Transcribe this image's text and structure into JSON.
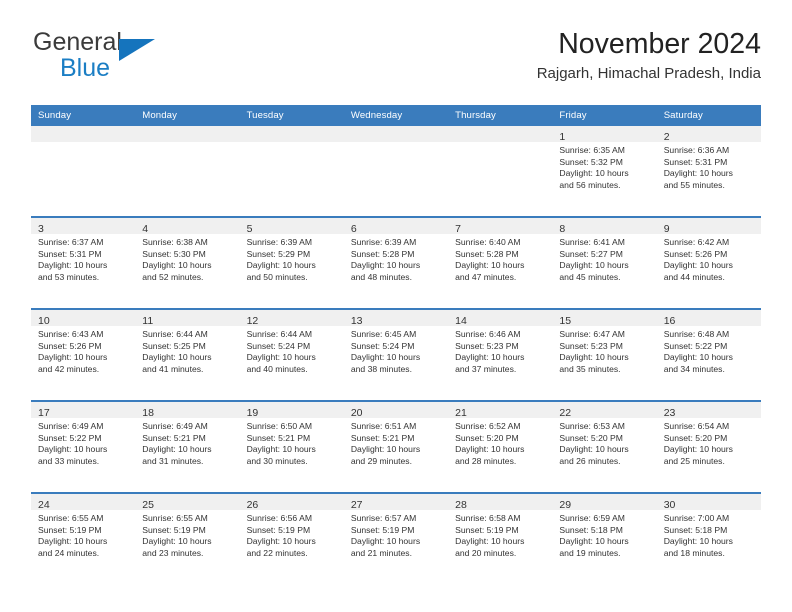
{
  "brand": {
    "name_top": "General",
    "name_bottom": "Blue",
    "color_dark": "#3b3b3b",
    "color_blue": "#1b7ec4",
    "triangle_color": "#1574bd"
  },
  "header": {
    "title": "November 2024",
    "subtitle": "Rajgarh, Himachal Pradesh, India"
  },
  "theme": {
    "header_blue": "#3a7cbd",
    "row_divider": "#3a7cbd",
    "daynum_band": "#f0f0f0",
    "text": "#333333"
  },
  "weekday_headers": [
    "Sunday",
    "Monday",
    "Tuesday",
    "Wednesday",
    "Thursday",
    "Friday",
    "Saturday"
  ],
  "weeks": [
    [
      {
        "day": "",
        "sunrise": "",
        "sunset": "",
        "daylight_1": "",
        "daylight_2": ""
      },
      {
        "day": "",
        "sunrise": "",
        "sunset": "",
        "daylight_1": "",
        "daylight_2": ""
      },
      {
        "day": "",
        "sunrise": "",
        "sunset": "",
        "daylight_1": "",
        "daylight_2": ""
      },
      {
        "day": "",
        "sunrise": "",
        "sunset": "",
        "daylight_1": "",
        "daylight_2": ""
      },
      {
        "day": "",
        "sunrise": "",
        "sunset": "",
        "daylight_1": "",
        "daylight_2": ""
      },
      {
        "day": "1",
        "sunrise": "Sunrise: 6:35 AM",
        "sunset": "Sunset: 5:32 PM",
        "daylight_1": "Daylight: 10 hours",
        "daylight_2": "and 56 minutes."
      },
      {
        "day": "2",
        "sunrise": "Sunrise: 6:36 AM",
        "sunset": "Sunset: 5:31 PM",
        "daylight_1": "Daylight: 10 hours",
        "daylight_2": "and 55 minutes."
      }
    ],
    [
      {
        "day": "3",
        "sunrise": "Sunrise: 6:37 AM",
        "sunset": "Sunset: 5:31 PM",
        "daylight_1": "Daylight: 10 hours",
        "daylight_2": "and 53 minutes."
      },
      {
        "day": "4",
        "sunrise": "Sunrise: 6:38 AM",
        "sunset": "Sunset: 5:30 PM",
        "daylight_1": "Daylight: 10 hours",
        "daylight_2": "and 52 minutes."
      },
      {
        "day": "5",
        "sunrise": "Sunrise: 6:39 AM",
        "sunset": "Sunset: 5:29 PM",
        "daylight_1": "Daylight: 10 hours",
        "daylight_2": "and 50 minutes."
      },
      {
        "day": "6",
        "sunrise": "Sunrise: 6:39 AM",
        "sunset": "Sunset: 5:28 PM",
        "daylight_1": "Daylight: 10 hours",
        "daylight_2": "and 48 minutes."
      },
      {
        "day": "7",
        "sunrise": "Sunrise: 6:40 AM",
        "sunset": "Sunset: 5:28 PM",
        "daylight_1": "Daylight: 10 hours",
        "daylight_2": "and 47 minutes."
      },
      {
        "day": "8",
        "sunrise": "Sunrise: 6:41 AM",
        "sunset": "Sunset: 5:27 PM",
        "daylight_1": "Daylight: 10 hours",
        "daylight_2": "and 45 minutes."
      },
      {
        "day": "9",
        "sunrise": "Sunrise: 6:42 AM",
        "sunset": "Sunset: 5:26 PM",
        "daylight_1": "Daylight: 10 hours",
        "daylight_2": "and 44 minutes."
      }
    ],
    [
      {
        "day": "10",
        "sunrise": "Sunrise: 6:43 AM",
        "sunset": "Sunset: 5:26 PM",
        "daylight_1": "Daylight: 10 hours",
        "daylight_2": "and 42 minutes."
      },
      {
        "day": "11",
        "sunrise": "Sunrise: 6:44 AM",
        "sunset": "Sunset: 5:25 PM",
        "daylight_1": "Daylight: 10 hours",
        "daylight_2": "and 41 minutes."
      },
      {
        "day": "12",
        "sunrise": "Sunrise: 6:44 AM",
        "sunset": "Sunset: 5:24 PM",
        "daylight_1": "Daylight: 10 hours",
        "daylight_2": "and 40 minutes."
      },
      {
        "day": "13",
        "sunrise": "Sunrise: 6:45 AM",
        "sunset": "Sunset: 5:24 PM",
        "daylight_1": "Daylight: 10 hours",
        "daylight_2": "and 38 minutes."
      },
      {
        "day": "14",
        "sunrise": "Sunrise: 6:46 AM",
        "sunset": "Sunset: 5:23 PM",
        "daylight_1": "Daylight: 10 hours",
        "daylight_2": "and 37 minutes."
      },
      {
        "day": "15",
        "sunrise": "Sunrise: 6:47 AM",
        "sunset": "Sunset: 5:23 PM",
        "daylight_1": "Daylight: 10 hours",
        "daylight_2": "and 35 minutes."
      },
      {
        "day": "16",
        "sunrise": "Sunrise: 6:48 AM",
        "sunset": "Sunset: 5:22 PM",
        "daylight_1": "Daylight: 10 hours",
        "daylight_2": "and 34 minutes."
      }
    ],
    [
      {
        "day": "17",
        "sunrise": "Sunrise: 6:49 AM",
        "sunset": "Sunset: 5:22 PM",
        "daylight_1": "Daylight: 10 hours",
        "daylight_2": "and 33 minutes."
      },
      {
        "day": "18",
        "sunrise": "Sunrise: 6:49 AM",
        "sunset": "Sunset: 5:21 PM",
        "daylight_1": "Daylight: 10 hours",
        "daylight_2": "and 31 minutes."
      },
      {
        "day": "19",
        "sunrise": "Sunrise: 6:50 AM",
        "sunset": "Sunset: 5:21 PM",
        "daylight_1": "Daylight: 10 hours",
        "daylight_2": "and 30 minutes."
      },
      {
        "day": "20",
        "sunrise": "Sunrise: 6:51 AM",
        "sunset": "Sunset: 5:21 PM",
        "daylight_1": "Daylight: 10 hours",
        "daylight_2": "and 29 minutes."
      },
      {
        "day": "21",
        "sunrise": "Sunrise: 6:52 AM",
        "sunset": "Sunset: 5:20 PM",
        "daylight_1": "Daylight: 10 hours",
        "daylight_2": "and 28 minutes."
      },
      {
        "day": "22",
        "sunrise": "Sunrise: 6:53 AM",
        "sunset": "Sunset: 5:20 PM",
        "daylight_1": "Daylight: 10 hours",
        "daylight_2": "and 26 minutes."
      },
      {
        "day": "23",
        "sunrise": "Sunrise: 6:54 AM",
        "sunset": "Sunset: 5:20 PM",
        "daylight_1": "Daylight: 10 hours",
        "daylight_2": "and 25 minutes."
      }
    ],
    [
      {
        "day": "24",
        "sunrise": "Sunrise: 6:55 AM",
        "sunset": "Sunset: 5:19 PM",
        "daylight_1": "Daylight: 10 hours",
        "daylight_2": "and 24 minutes."
      },
      {
        "day": "25",
        "sunrise": "Sunrise: 6:55 AM",
        "sunset": "Sunset: 5:19 PM",
        "daylight_1": "Daylight: 10 hours",
        "daylight_2": "and 23 minutes."
      },
      {
        "day": "26",
        "sunrise": "Sunrise: 6:56 AM",
        "sunset": "Sunset: 5:19 PM",
        "daylight_1": "Daylight: 10 hours",
        "daylight_2": "and 22 minutes."
      },
      {
        "day": "27",
        "sunrise": "Sunrise: 6:57 AM",
        "sunset": "Sunset: 5:19 PM",
        "daylight_1": "Daylight: 10 hours",
        "daylight_2": "and 21 minutes."
      },
      {
        "day": "28",
        "sunrise": "Sunrise: 6:58 AM",
        "sunset": "Sunset: 5:19 PM",
        "daylight_1": "Daylight: 10 hours",
        "daylight_2": "and 20 minutes."
      },
      {
        "day": "29",
        "sunrise": "Sunrise: 6:59 AM",
        "sunset": "Sunset: 5:18 PM",
        "daylight_1": "Daylight: 10 hours",
        "daylight_2": "and 19 minutes."
      },
      {
        "day": "30",
        "sunrise": "Sunrise: 7:00 AM",
        "sunset": "Sunset: 5:18 PM",
        "daylight_1": "Daylight: 10 hours",
        "daylight_2": "and 18 minutes."
      }
    ]
  ]
}
